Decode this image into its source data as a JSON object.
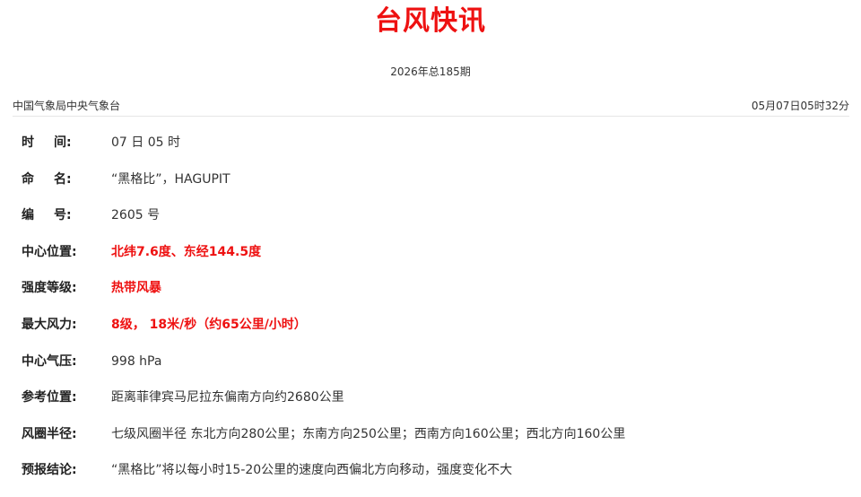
{
  "header": {
    "title": "台风快讯",
    "issue": "2026年总185期",
    "agency": "中国气象局中央气象台",
    "timestamp": "05月07日05时32分"
  },
  "fields": [
    {
      "key": "time",
      "label_a": "时",
      "label_b": "间:",
      "value": "07 日 05 时",
      "highlight": false
    },
    {
      "key": "name",
      "label_a": "命",
      "label_b": "名:",
      "value": "“黑格比”，HAGUPIT",
      "highlight": false
    },
    {
      "key": "number",
      "label_a": "编",
      "label_b": "号:",
      "value": "2605 号",
      "highlight": false
    },
    {
      "key": "center-position",
      "label": "中心位置:",
      "value": "北纬7.6度、东经144.5度",
      "highlight": true
    },
    {
      "key": "intensity-level",
      "label": "强度等级:",
      "value": "热带风暴",
      "highlight": true
    },
    {
      "key": "max-wind",
      "label": "最大风力:",
      "value": "8级， 18米/秒（约65公里/小时）",
      "highlight": true
    },
    {
      "key": "center-pressure",
      "label": "中心气压:",
      "value": "998 hPa",
      "highlight": false
    },
    {
      "key": "reference-position",
      "label": "参考位置:",
      "value": "距离菲律宾马尼拉东偏南方向约2680公里",
      "highlight": false
    },
    {
      "key": "wind-radius",
      "label": "风圈半径:",
      "value": "七级风圈半径 东北方向280公里；东南方向250公里；西南方向160公里；西北方向160公里",
      "highlight": false
    },
    {
      "key": "forecast",
      "label": "预报结论:",
      "value": "“黑格比”将以每小时15-20公里的速度向西偏北方向移动，强度变化不大",
      "highlight": false
    }
  ],
  "colors": {
    "title": "#ee1111",
    "highlight": "#ee1111",
    "text": "#333333",
    "divider": "#e6e6e6"
  }
}
